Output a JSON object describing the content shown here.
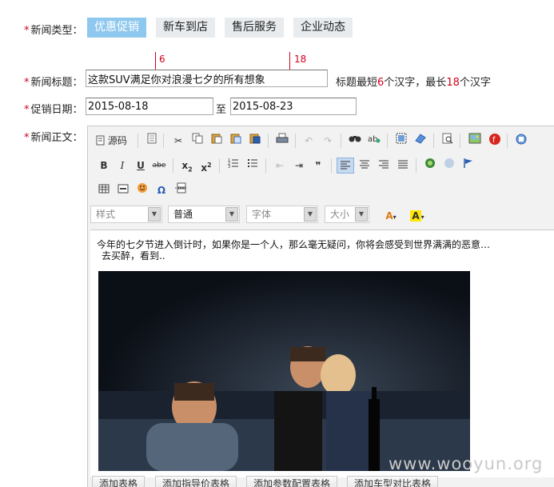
{
  "form": {
    "required_mark": "*",
    "type_label": "新闻类型：",
    "type_tabs": [
      "优惠促销",
      "新车到店",
      "售后服务",
      "企业动态"
    ],
    "title_label": "新闻标题：",
    "title_value": "这款SUV满足你对浪漫七夕的所有想象",
    "marker_min": "6",
    "marker_max": "18",
    "hint_pre": "标题最短",
    "hint_min": "6",
    "hint_mid": "个汉字，最长",
    "hint_max": "18",
    "hint_post": "个汉字",
    "date_label": "促销日期：",
    "date_start": "2015-08-18",
    "date_to": "至",
    "date_end": "2015-08-23",
    "body_label": "新闻正文："
  },
  "editor": {
    "source_label": "源码",
    "style_combo": "样式",
    "format_combo": "普通",
    "font_combo": "字体",
    "size_combo": "大小",
    "content_line1": "今年的七夕节进入倒计时，如果你是一个人，那么毫无疑问，你将会感受到世界满满的恶意…",
    "content_line2": "去买醉，看到..",
    "icons": [
      "doc-icon",
      "template-icon",
      "cut-icon",
      "copy-icon",
      "paste-icon",
      "paste-text-icon",
      "paste-word-icon",
      "print-icon",
      "undo-icon",
      "redo-icon",
      "find-icon",
      "replace-icon",
      "select-all-icon",
      "remove-format-icon",
      "preview-icon",
      "image-icon",
      "flash-icon",
      "anchor-icon"
    ]
  },
  "bottom_buttons": [
    "添加表格",
    "添加指导价表格",
    "添加参数配置表格",
    "添加车型对比表格"
  ],
  "watermark": "www.wooyun.org"
}
